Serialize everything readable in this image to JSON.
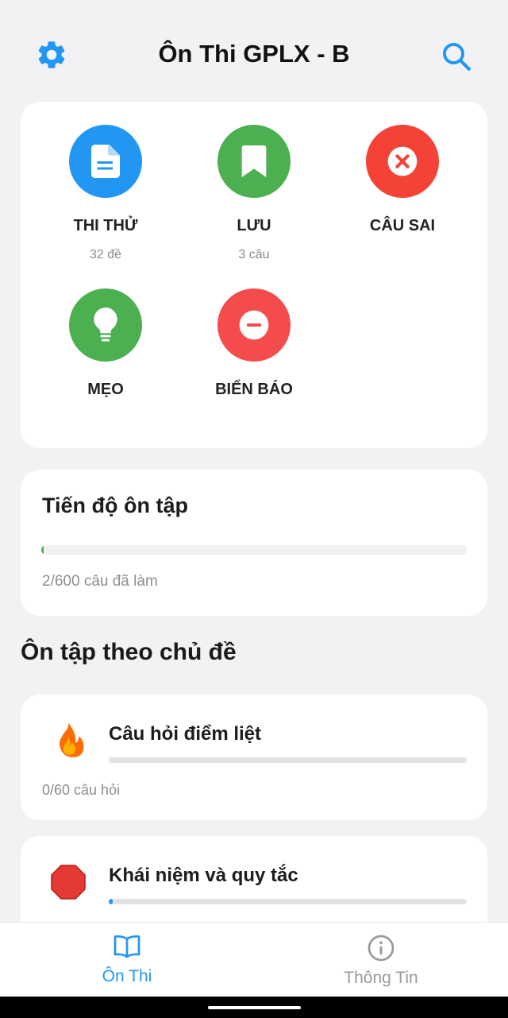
{
  "header": {
    "title": "Ôn Thi GPLX - B",
    "accent_color": "#2196f3",
    "left_icon": "gear-icon",
    "right_icon": "search-icon"
  },
  "menu": [
    {
      "label": "THI THỬ",
      "sub": "32 đề",
      "icon": "document-icon",
      "color": "#2196f3"
    },
    {
      "label": "LƯU",
      "sub": "3 câu",
      "icon": "bookmark-icon",
      "color": "#4caf50"
    },
    {
      "label": "CÂU SAI",
      "sub": "",
      "icon": "close-circle-icon",
      "color": "#f44336"
    },
    {
      "label": "MẸO",
      "sub": "",
      "icon": "lightbulb-icon",
      "color": "#4caf50"
    },
    {
      "label": "BIỂN BÁO",
      "sub": "",
      "icon": "minus-circle-icon",
      "color": "#f44c4c"
    }
  ],
  "progress": {
    "title": "Tiến độ ôn tập",
    "done": 2,
    "total": 600,
    "text": "2/600 câu đã làm",
    "bar_color": "#4caf50"
  },
  "section_title": "Ôn tập theo chủ đề",
  "topics": [
    {
      "name": "Câu hỏi điểm liệt",
      "count_text": "0/60 câu hỏi",
      "progress": 0,
      "icon": "fire-icon"
    },
    {
      "name": "Khái niệm và quy tắc",
      "count_text": "",
      "progress": 0.01,
      "icon": "stop-sign-icon"
    }
  ],
  "bottom_nav": [
    {
      "label": "Ôn Thi",
      "icon": "book-icon",
      "active": true
    },
    {
      "label": "Thông Tin",
      "icon": "info-icon",
      "active": false
    }
  ]
}
